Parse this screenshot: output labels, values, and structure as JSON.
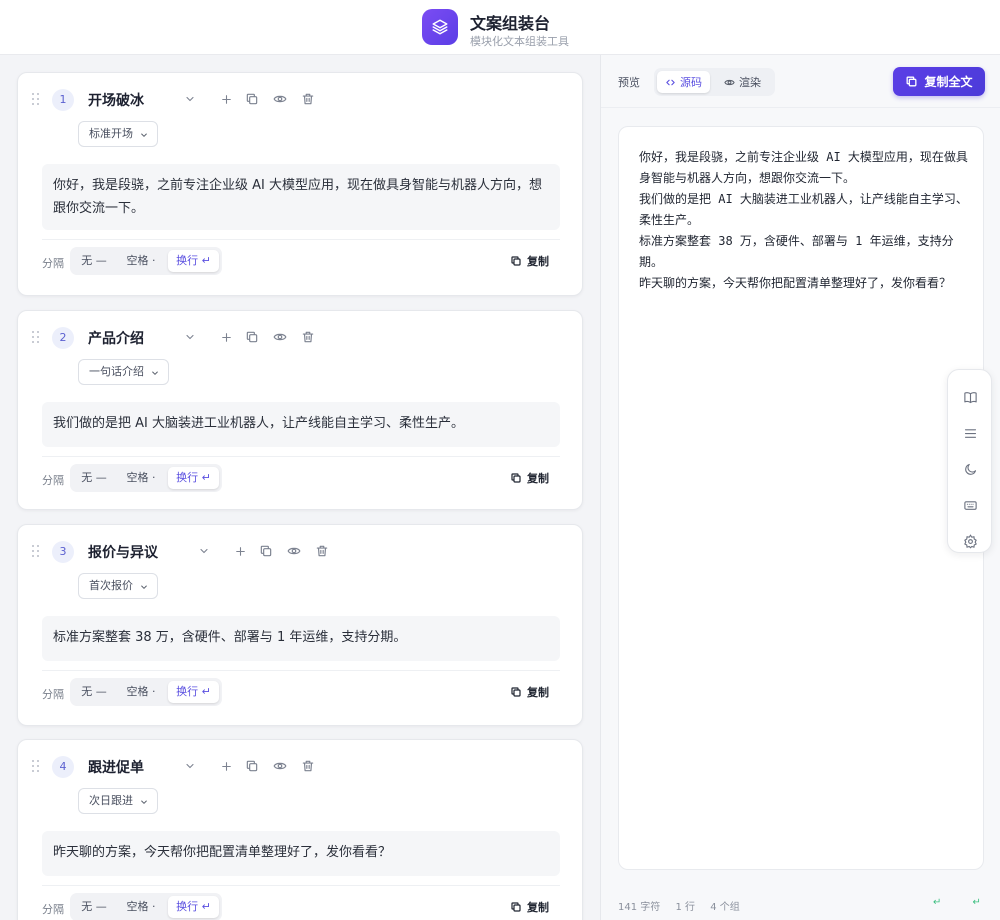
{
  "app": {
    "title": "文案组装台",
    "subtitle": "模块化文本组装工具"
  },
  "blocks": [
    {
      "index": "1",
      "title": "开场破冰",
      "variant": "标准开场",
      "text": "你好，我是段骁，之前专注企业级 AI 大模型应用，现在做具身智能与机器人方向，想跟你交流一下。",
      "separator_label": "分隔",
      "sep_options": [
        "无 —",
        "空格 ·",
        "换行 ↵"
      ],
      "sep_selected": "换行 ↵",
      "copy_label": "复制"
    },
    {
      "index": "2",
      "title": "产品介绍",
      "variant": "一句话介绍",
      "text": "我们做的是把 AI 大脑装进工业机器人，让产线能自主学习、柔性生产。",
      "separator_label": "分隔",
      "sep_options": [
        "无 —",
        "空格 ·",
        "换行 ↵"
      ],
      "sep_selected": "换行 ↵",
      "copy_label": "复制"
    },
    {
      "index": "3",
      "title": "报价与异议",
      "variant": "首次报价",
      "text": "标准方案整套 38 万，含硬件、部署与 1 年运维，支持分期。",
      "separator_label": "分隔",
      "sep_options": [
        "无 —",
        "空格 ·",
        "换行 ↵"
      ],
      "sep_selected": "换行 ↵",
      "copy_label": "复制"
    },
    {
      "index": "4",
      "title": "跟进促单",
      "variant": "次日跟进",
      "text": "昨天聊的方案，今天帮你把配置清单整理好了，发你看看？",
      "separator_label": "分隔",
      "sep_options": [
        "无 —",
        "空格 ·",
        "换行 ↵"
      ],
      "sep_selected": "换行 ↵",
      "copy_label": "复制"
    }
  ],
  "preview": {
    "label": "预览",
    "view_options": [
      "源码",
      "渲染"
    ],
    "view_selected": "源码",
    "copy_all_label": "复制全文",
    "lines": [
      "你好，我是段骁，之前专注企业级 AI 大模型应用，现在做具身智能与机器人方向，想跟你交流一下。",
      "我们做的是把 AI 大脑装进工业机器人，让产线能自主学习、柔性生产。",
      "标准方案整套 38 万，含硬件、部署与 1 年运维，支持分期。",
      "昨天聊的方案，今天帮你把配置清单整理好了，发你看看？"
    ]
  },
  "side_toolbar": [
    "book-icon",
    "list-icon",
    "moon-icon",
    "keyboard-icon",
    "settings-icon"
  ],
  "status": {
    "chars": "141 字符",
    "lines": "1 行",
    "groups": "4 个组",
    "marks": "↵ ↵ ↵"
  },
  "colors": {
    "accent": "#5b3ee6",
    "accent_text": "#5a4fe0",
    "success": "#3cbf80"
  }
}
